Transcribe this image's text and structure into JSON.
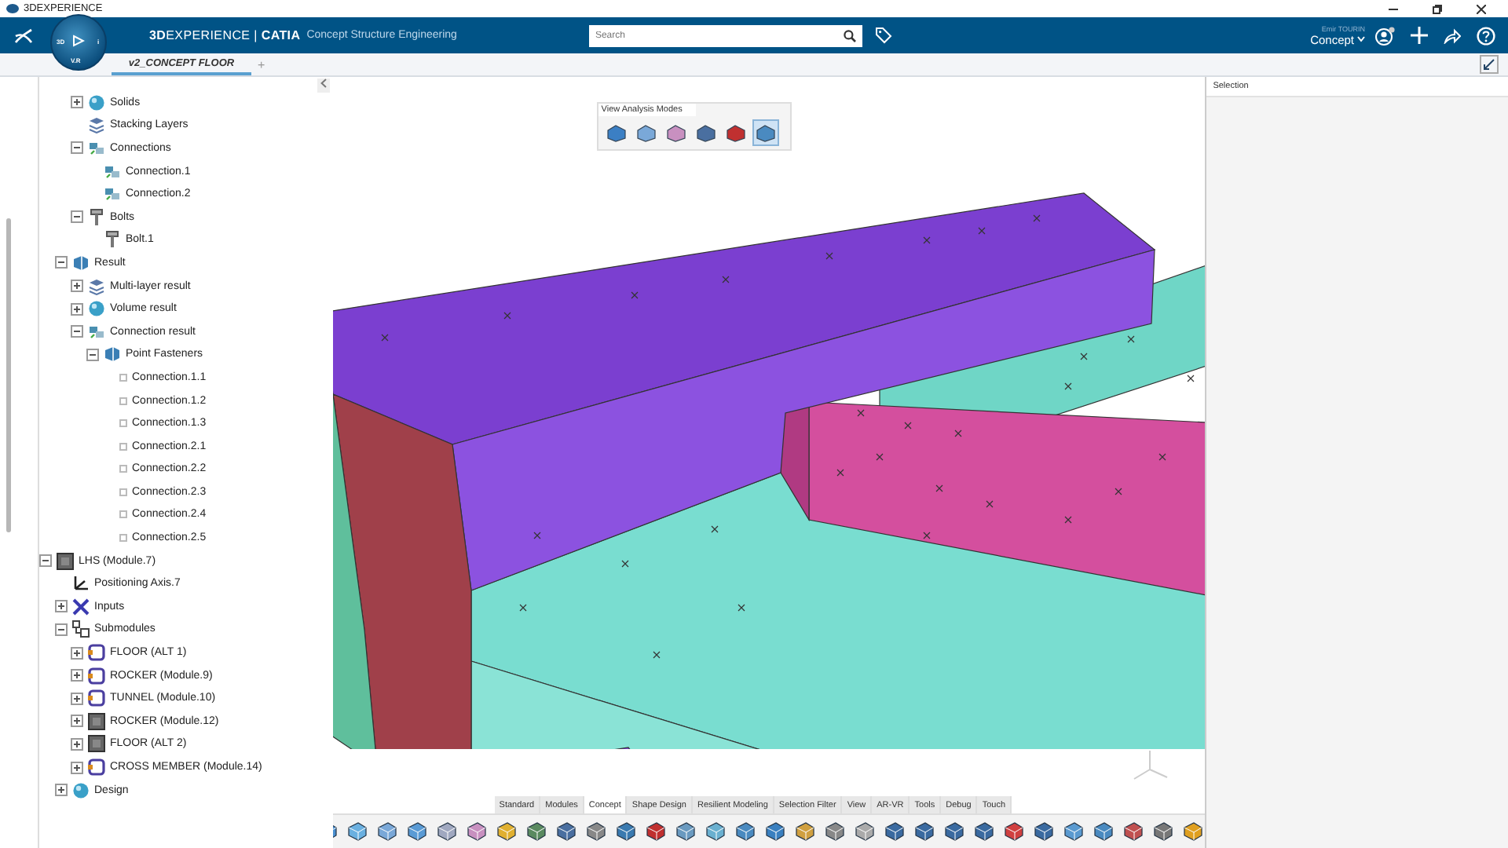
{
  "window": {
    "title": "3DEXPERIENCE"
  },
  "header": {
    "compass_labels": [
      "3D",
      "V.R",
      "i"
    ],
    "brand": "**3D**EXPERIENCE | **CATIA**",
    "app": "Concept Structure Engineering",
    "search": {
      "placeholder": "Search"
    },
    "user": "Emir TOURIN",
    "role": "Concept"
  },
  "tabs": [
    {
      "label": "v2_CONCEPT FLOOR",
      "selected": true
    }
  ],
  "new_tab": "+",
  "tree": {
    "scrolled_parent": {
      "children": [
        {
          "label": "Solids",
          "kind": "solid",
          "expanded": false
        },
        {
          "label": "Stacking Layers",
          "kind": "layer"
        },
        {
          "label": "Connections",
          "kind": "connection",
          "expanded": true,
          "children": [
            {
              "label": "Connection.1",
              "kind": "connection"
            },
            {
              "label": "Connection.2",
              "kind": "connection"
            }
          ]
        },
        {
          "label": "Bolts",
          "kind": "bolt",
          "expanded": true,
          "children": [
            {
              "label": "Bolt.1",
              "kind": "bolt"
            }
          ]
        }
      ]
    },
    "continued": [
      {
        "label": "Result",
        "kind": "result",
        "expanded": true,
        "children": [
          {
            "label": "Multi-layer result",
            "kind": "layer",
            "expanded": false
          },
          {
            "label": "Volume result",
            "kind": "solid",
            "expanded": false
          },
          {
            "label": "Connection result",
            "kind": "connection",
            "expanded": true,
            "children": [
              {
                "label": "Point Fasteners",
                "kind": "result",
                "expanded": true,
                "children": [
                  {
                    "label": "Connection.1.1",
                    "kind": "point"
                  },
                  {
                    "label": "Connection.1.2",
                    "kind": "point"
                  },
                  {
                    "label": "Connection.1.3",
                    "kind": "point"
                  },
                  {
                    "label": "Connection.2.1",
                    "kind": "point"
                  },
                  {
                    "label": "Connection.2.2",
                    "kind": "point"
                  },
                  {
                    "label": "Connection.2.3",
                    "kind": "point"
                  },
                  {
                    "label": "Connection.2.4",
                    "kind": "point"
                  },
                  {
                    "label": "Connection.2.5",
                    "kind": "point"
                  }
                ]
              }
            ]
          }
        ]
      }
    ],
    "items": [
      {
        "label": "LHS (Module.7)",
        "kind": "part",
        "expanded": true,
        "children": [
          {
            "label": "Positioning Axis.7",
            "kind": "axis"
          },
          {
            "label": "Inputs",
            "kind": "inputs",
            "expanded": false
          },
          {
            "label": "Submodules",
            "kind": "submodules",
            "expanded": true,
            "children": [
              {
                "label": "FLOOR (ALT 1)",
                "kind": "module",
                "expanded": false
              },
              {
                "label": "ROCKER (Module.9)",
                "kind": "module",
                "expanded": false
              },
              {
                "label": "TUNNEL (Module.10)",
                "kind": "module",
                "expanded": false
              },
              {
                "label": "ROCKER (Module.12)",
                "kind": "part",
                "expanded": false
              },
              {
                "label": "FLOOR (ALT 2)",
                "kind": "part",
                "expanded": false
              },
              {
                "label": "CROSS MEMBER (Module.14)",
                "kind": "module",
                "expanded": false
              }
            ]
          },
          {
            "label": "Design",
            "kind": "solid",
            "expanded": false
          }
        ]
      }
    ]
  },
  "analysis_toolbar": {
    "title": "View Analysis Modes",
    "tools": [
      {
        "selected": false
      },
      {
        "selected": false
      },
      {
        "selected": false
      },
      {
        "selected": false
      },
      {
        "selected": false
      },
      {
        "selected": true
      }
    ]
  },
  "right_panel": {
    "title": "Selection"
  },
  "action_bar": {
    "tabs": [
      {
        "label": "Standard",
        "selected": false
      },
      {
        "label": "Modules",
        "selected": false
      },
      {
        "label": "Concept",
        "selected": true
      },
      {
        "label": "Shape Design",
        "selected": false
      },
      {
        "label": "Resilient Modeling",
        "selected": false
      },
      {
        "label": "Selection Filter",
        "selected": false
      },
      {
        "label": "View",
        "selected": false
      },
      {
        "label": "AR-VR",
        "selected": false
      },
      {
        "label": "Tools",
        "selected": false
      },
      {
        "label": "Debug",
        "selected": false
      },
      {
        "label": "Touch",
        "selected": false
      }
    ]
  }
}
